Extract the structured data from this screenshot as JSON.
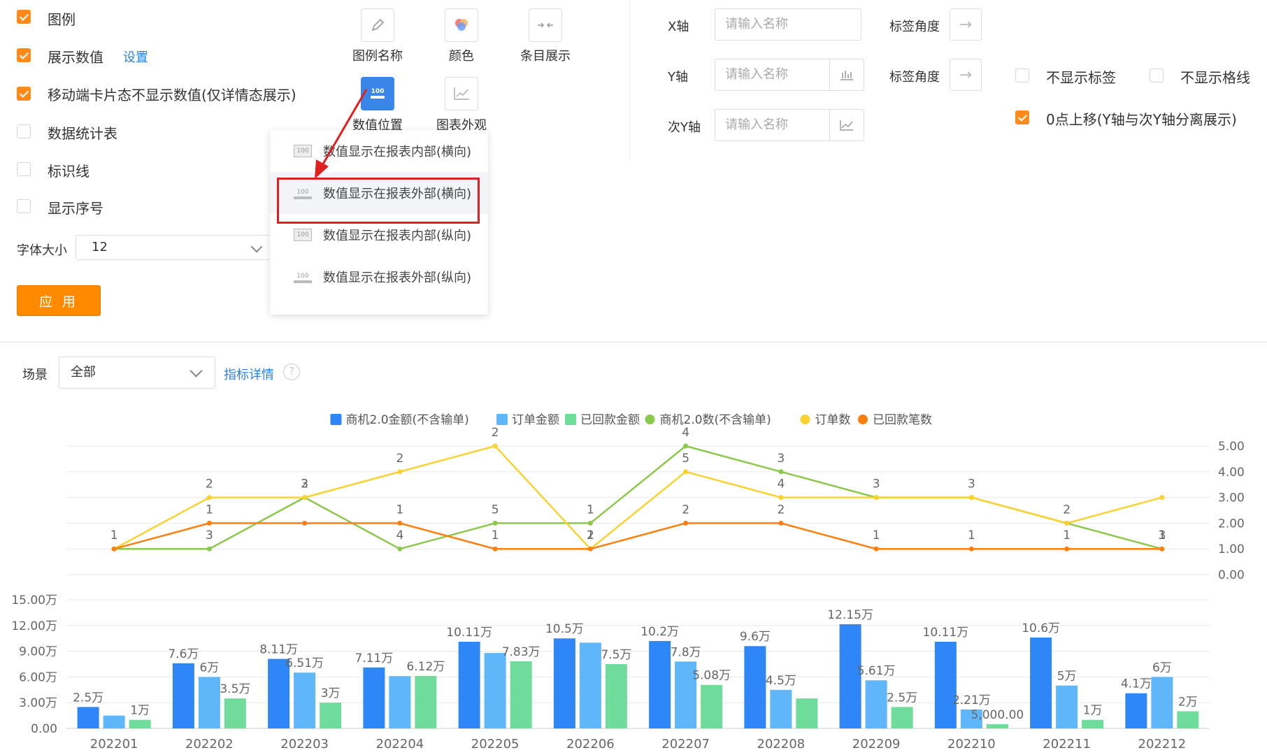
{
  "options": [
    {
      "label": "图例",
      "checked": true
    },
    {
      "label": "展示数值",
      "checked": true,
      "link": "设置"
    },
    {
      "label": "移动端卡片态不显示数值(仅详情态展示)",
      "checked": true
    },
    {
      "label": "数据统计表",
      "checked": false
    },
    {
      "label": "标识线",
      "checked": false
    },
    {
      "label": "显示序号",
      "checked": false
    }
  ],
  "font_size": {
    "label": "字体大小",
    "value": "12"
  },
  "apply_label": "应 用",
  "tools": [
    {
      "label": "图例名称",
      "icon": "pencil-icon"
    },
    {
      "label": "颜色",
      "icon": "palette-icon"
    },
    {
      "label": "条目展示",
      "icon": "compress-icon"
    },
    {
      "label": "数值位置",
      "icon": "value-position-icon",
      "active": true
    },
    {
      "label": "图表外观",
      "icon": "chart-appearance-icon"
    }
  ],
  "position_menu": {
    "icon_text": "100",
    "items": [
      "数值显示在报表内部(横向)",
      "数值显示在报表外部(横向)",
      "数值显示在报表内部(纵向)",
      "数值显示在报表外部(纵向)"
    ],
    "highlighted_index": 1
  },
  "axes": {
    "x_label": "X轴",
    "y_label": "Y轴",
    "y2_label": "次Y轴",
    "placeholder": "请输入名称",
    "angle_label": "标签角度",
    "hide_labels": "不显示标签",
    "hide_grid": "不显示格线",
    "zero_up": "0点上移(Y轴与次Y轴分离展示)",
    "hide_labels_checked": false,
    "hide_grid_checked": false,
    "zero_up_checked": true
  },
  "scene": {
    "label": "场景",
    "value": "全部",
    "detail_link": "指标详情",
    "help": "?"
  },
  "chart_data": {
    "type": "bar",
    "categories": [
      "202201",
      "202202",
      "202203",
      "202204",
      "202205",
      "202206",
      "202207",
      "202208",
      "202209",
      "202210",
      "202211",
      "202212"
    ],
    "bar_series": [
      {
        "name": "商机2.0金额(不含输单)",
        "color": "#2f86f6",
        "values": [
          2.5,
          7.6,
          8.11,
          7.11,
          10.11,
          10.5,
          10.2,
          9.6,
          12.15,
          10.11,
          10.6,
          4.1
        ],
        "labels": [
          "2.5万",
          "7.6万",
          "8.11万",
          "7.11万",
          "10.11万",
          "10.5万",
          "10.2万",
          "9.6万",
          "12.15万",
          "10.11万",
          "10.6万",
          "4.1万"
        ]
      },
      {
        "name": "订单金额",
        "color": "#5fb6f9",
        "values": [
          1.5,
          6,
          6.51,
          6.1,
          8.8,
          10,
          7.8,
          4.5,
          5.61,
          2.21,
          5,
          6
        ],
        "labels": [
          "",
          "6万",
          "6.51万",
          "",
          "",
          "",
          "7.8万",
          "4.5万",
          "5.61万",
          "2.21万",
          "5万",
          "6万"
        ]
      },
      {
        "name": "已回款金额",
        "color": "#6fdc9b",
        "values": [
          1,
          3.5,
          3,
          6.12,
          7.83,
          7.5,
          5.08,
          3.5,
          2.5,
          0.5,
          1,
          2
        ],
        "labels": [
          "1万",
          "3.5万",
          "3万",
          "6.12万",
          "7.83万",
          "7.5万",
          "5.08万",
          "",
          "2.5万",
          "5,000.00",
          "1万",
          "2万"
        ]
      }
    ],
    "line_series": [
      {
        "name": "商机2.0数(不含输单)",
        "color": "#8cc84b",
        "values": [
          1,
          1,
          3,
          1,
          2,
          2,
          5,
          4,
          3,
          3,
          2,
          1
        ]
      },
      {
        "name": "订单数",
        "color": "#f9d232",
        "values": [
          1,
          3,
          3,
          4,
          5,
          1,
          4,
          3,
          3,
          3,
          2,
          3
        ]
      },
      {
        "name": "已回款笔数",
        "color": "#ff7f0e",
        "values": [
          1,
          2,
          2,
          2,
          1,
          1,
          2,
          2,
          1,
          1,
          1,
          1
        ]
      }
    ],
    "line_point_labels": [
      [
        "1",
        "3",
        "3",
        "4",
        "5",
        "1",
        "4",
        "3",
        "3",
        "3",
        "2",
        "3"
      ],
      [
        "",
        "2",
        "2",
        "2",
        "2",
        "2",
        "5",
        "4",
        "",
        "",
        "",
        ""
      ],
      [
        "",
        "1",
        "",
        "1",
        "1",
        "1",
        "2",
        "2",
        "1",
        "1",
        "1",
        "1"
      ]
    ],
    "left_ticks": [
      "0.00",
      "3.00万",
      "6.00万",
      "9.00万",
      "12.00万",
      "15.00万"
    ],
    "left_ylim": [
      0,
      15
    ],
    "right_ticks": [
      "0.00",
      "1.00",
      "2.00",
      "3.00",
      "4.00",
      "5.00"
    ],
    "right_ylim": [
      0,
      5
    ],
    "legend_position": "top"
  }
}
